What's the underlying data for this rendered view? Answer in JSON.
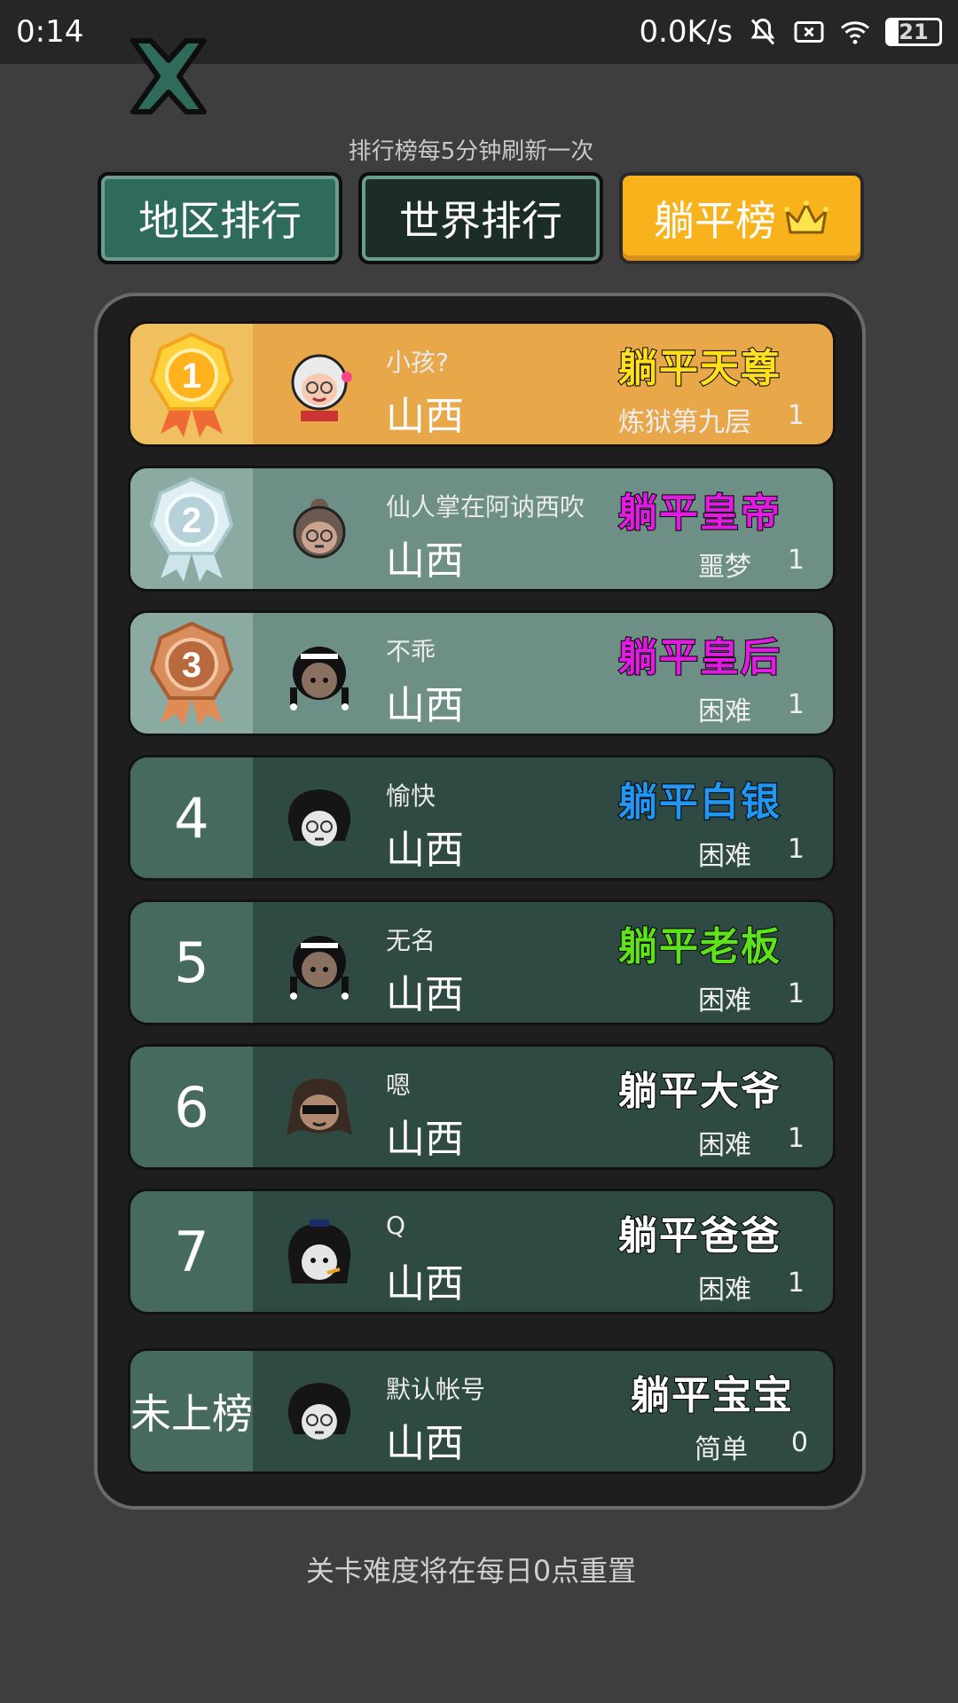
{
  "status_bar": {
    "time": "0:14",
    "net_speed": "0.0K/s",
    "battery": "21"
  },
  "refresh_note": "排行榜每5分钟刷新一次",
  "tabs": [
    {
      "label": "地区排行",
      "active": false
    },
    {
      "label": "世界排行",
      "active": false
    },
    {
      "label": "躺平榜",
      "active": true
    }
  ],
  "rows": [
    {
      "rank": "1",
      "name": "小孩?",
      "province": "山西",
      "title": "躺平天尊",
      "title_color": "#ffe01a",
      "difficulty": "炼狱第九层",
      "score": "1"
    },
    {
      "rank": "2",
      "name": "仙人掌在阿讷西吹",
      "province": "山西",
      "title": "躺平皇帝",
      "title_color": "#e21be2",
      "difficulty": "噩梦",
      "score": "1"
    },
    {
      "rank": "3",
      "name": "不乖",
      "province": "山西",
      "title": "躺平皇后",
      "title_color": "#e21be2",
      "difficulty": "困难",
      "score": "1"
    },
    {
      "rank": "4",
      "name": "愉快",
      "province": "山西",
      "title": "躺平白银",
      "title_color": "#2196f3",
      "difficulty": "困难",
      "score": "1"
    },
    {
      "rank": "5",
      "name": "无名",
      "province": "山西",
      "title": "躺平老板",
      "title_color": "#5ee31a",
      "difficulty": "困难",
      "score": "1"
    },
    {
      "rank": "6",
      "name": "嗯",
      "province": "山西",
      "title": "躺平大爷",
      "title_color": "#ffffff",
      "difficulty": "困难",
      "score": "1"
    },
    {
      "rank": "7",
      "name": "Q",
      "province": "山西",
      "title": "躺平爸爸",
      "title_color": "#ffffff",
      "difficulty": "困难",
      "score": "1"
    }
  ],
  "self_row": {
    "rank": "未上榜",
    "name": "默认帐号",
    "province": "山西",
    "title": "躺平宝宝",
    "title_color": "#ffffff",
    "difficulty": "简单",
    "score": "0"
  },
  "footer_note": "关卡难度将在每日0点重置"
}
